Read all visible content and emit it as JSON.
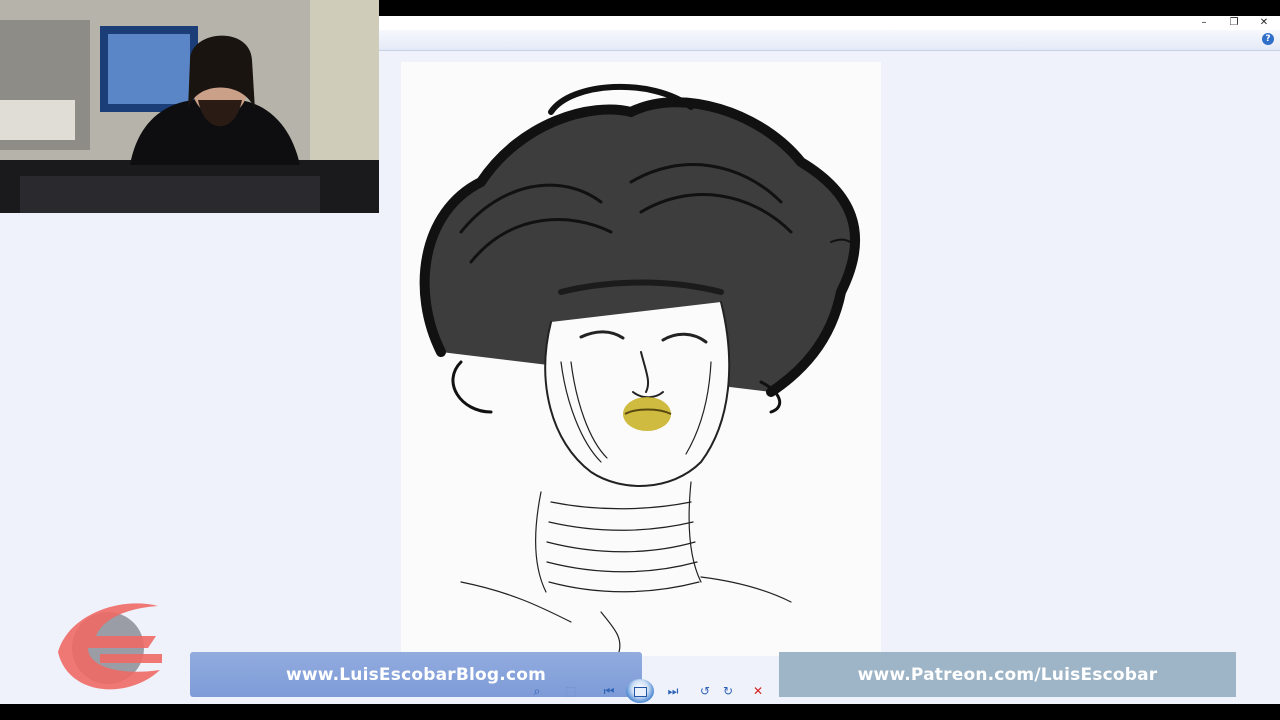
{
  "window": {
    "controls": {
      "minimize": "–",
      "restore": "❐",
      "close": "✕"
    },
    "help_glyph": "?"
  },
  "image": {
    "subject": "ink-drawing-portrait-with-yellow-lips",
    "highlight_color": "#c9b42a"
  },
  "banners": {
    "blog": "www.LuisEscobarBlog.com",
    "patreon": "www.Patreon.com/LuisEscobar"
  },
  "toolbar": {
    "zoom": "⌕",
    "fit": "⬚",
    "prev": "⏮",
    "next": "⏭",
    "rotate_ccw": "↺",
    "rotate_cw": "↻",
    "delete": "✕"
  },
  "colors": {
    "viewer_bg": "#eff2fb",
    "banner_blog": "#8aa6dc",
    "banner_patreon": "#9eb4c7",
    "delete_red": "#d62020",
    "logo_red": "#ee6a66",
    "logo_grey": "#8b8e96"
  }
}
